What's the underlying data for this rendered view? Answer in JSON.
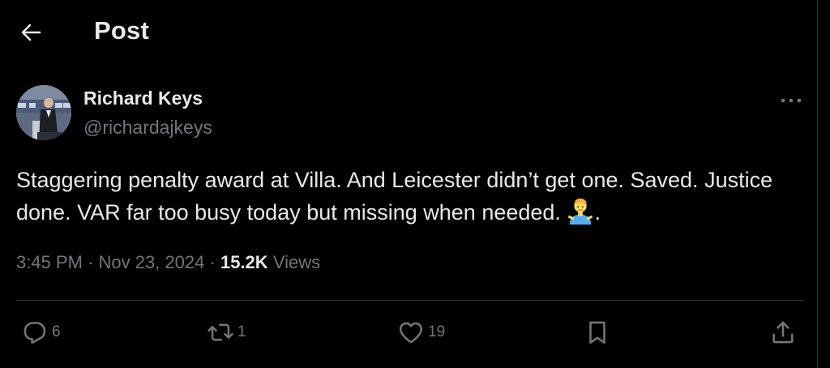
{
  "header": {
    "title": "Post",
    "back_icon": "arrow-left-icon"
  },
  "author": {
    "name": "Richard Keys",
    "handle": "@richardajkeys"
  },
  "tweet": {
    "text": "Staggering penalty award at Villa. And Leicester didn’t get one. Saved. Justice done. VAR far too busy today but missing when needed.",
    "emoji": "person-shrugging-icon",
    "trailing": "."
  },
  "meta": {
    "time": "3:45 PM",
    "separator": "·",
    "date": "Nov 23, 2024",
    "views_count": "15.2K",
    "views_label": "Views"
  },
  "actions": {
    "replies": "6",
    "reposts": "1",
    "likes": "19"
  },
  "colors": {
    "background": "#000000",
    "text_primary": "#e7e9ea",
    "text_secondary": "#71767b",
    "divider": "#2f3336"
  }
}
